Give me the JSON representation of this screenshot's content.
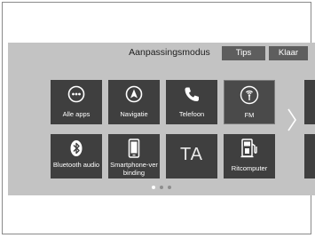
{
  "header": {
    "title": "Aanpassingsmodus",
    "tips_label": "Tips",
    "done_label": "Klaar"
  },
  "tiles": [
    {
      "label": "Alle apps",
      "icon": "grid-dots-icon"
    },
    {
      "label": "Navigatie",
      "icon": "compass-arrow-icon"
    },
    {
      "label": "Telefoon",
      "icon": "phone-icon"
    },
    {
      "label": "FM",
      "icon": "radio-antenna-icon"
    },
    {
      "label": "Bluetooth audio",
      "icon": "bluetooth-icon"
    },
    {
      "label": "Smartphone-verbinding",
      "icon": "smartphone-icon"
    },
    {
      "label": "TA"
    },
    {
      "label": "Ritcomputer",
      "icon": "fuel-pump-icon"
    }
  ],
  "pagination": {
    "pages": 3,
    "current": 1
  },
  "colors": {
    "screen_bg": "#c3c3c3",
    "tile_bg": "#3f3f3f",
    "button_bg": "#5e5e5e",
    "text_light": "#ffffff"
  }
}
